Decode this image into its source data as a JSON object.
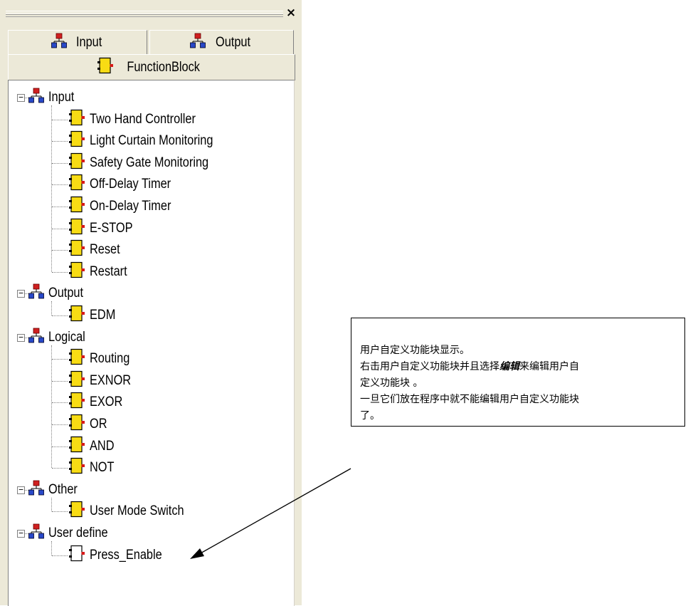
{
  "panel": {
    "close_glyph": "×",
    "tabs": {
      "input": "Input",
      "output": "Output",
      "function_block": "FunctionBlock"
    }
  },
  "tree": [
    {
      "group": "Input",
      "items": [
        "Two Hand Controller",
        "Light Curtain Monitoring",
        "Safety Gate Monitoring",
        "Off-Delay Timer",
        "On-Delay Timer",
        "E-STOP",
        "Reset",
        "Restart"
      ]
    },
    {
      "group": "Output",
      "items": [
        "EDM"
      ]
    },
    {
      "group": "Logical",
      "items": [
        "Routing",
        "EXNOR",
        "EXOR",
        "OR",
        "AND",
        "NOT"
      ]
    },
    {
      "group": "Other",
      "items": [
        "User Mode Switch"
      ]
    },
    {
      "group": "User define",
      "items": [
        "Press_Enable"
      ],
      "item_style": "outline"
    }
  ],
  "callout": {
    "line1": "用户自定义功能块显示。",
    "line2_prefix": "右击用户自定义功能块并且选择",
    "line2_emph": "编辑",
    "line2_suffix": "来编辑用户自",
    "line3": "定义功能块 。",
    "line4": "一旦它们放在程序中就不能编辑用户自定义功能块",
    "line5": "了。"
  },
  "colors": {
    "panel_bg": "#ece9d8",
    "block_fill": "#f8dc14",
    "block_pin": "#d81818",
    "network_red": "#d02020",
    "network_blue": "#2848c8"
  },
  "icons": {
    "network": "network-icon",
    "block": "function-block-icon",
    "user_block": "user-function-block-icon",
    "close": "close-icon"
  }
}
